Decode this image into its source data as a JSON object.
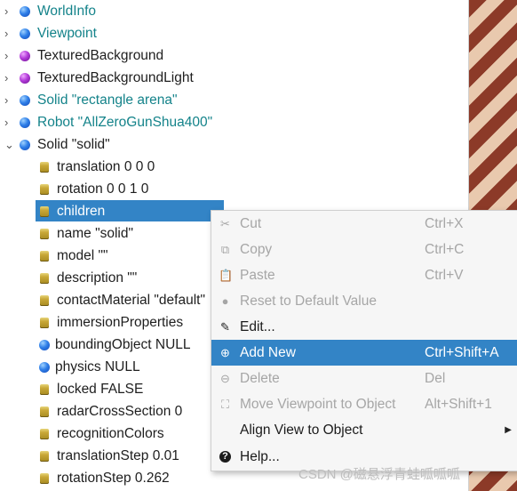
{
  "scene_tree": {
    "nodes": [
      {
        "label": "WorldInfo",
        "expander": "›",
        "icon": "blue-sphere-icon",
        "style": "teal"
      },
      {
        "label": "Viewpoint",
        "expander": "›",
        "icon": "blue-sphere-icon",
        "style": "teal"
      },
      {
        "label": "TexturedBackground",
        "expander": "›",
        "icon": "purple-sphere-icon",
        "style": "normal"
      },
      {
        "label": "TexturedBackgroundLight",
        "expander": "›",
        "icon": "purple-sphere-icon",
        "style": "normal"
      },
      {
        "label": "Solid \"rectangle arena\"",
        "expander": "›",
        "icon": "blue-sphere-icon",
        "style": "teal"
      },
      {
        "label": "Robot \"AllZeroGunShua400\"",
        "expander": "›",
        "icon": "blue-sphere-icon",
        "style": "teal"
      },
      {
        "label": "Solid \"solid\"",
        "expander": "⌄",
        "icon": "blue-sphere-icon",
        "style": "normal"
      }
    ],
    "fields": [
      {
        "label": "translation 0 0 0",
        "icon": "field-icon"
      },
      {
        "label": "rotation 0 0 1 0",
        "icon": "field-icon"
      },
      {
        "label": "children",
        "icon": "field-icon",
        "selected": true
      },
      {
        "label": "name \"solid\"",
        "icon": "field-icon"
      },
      {
        "label": "model \"\"",
        "icon": "field-icon"
      },
      {
        "label": "description \"\"",
        "icon": "field-icon"
      },
      {
        "label": "contactMaterial \"default\"",
        "icon": "field-icon"
      },
      {
        "label": "immersionProperties",
        "icon": "field-icon"
      },
      {
        "label": "boundingObject NULL",
        "icon": "blue-sphere-icon"
      },
      {
        "label": "physics NULL",
        "icon": "blue-sphere-icon"
      },
      {
        "label": "locked FALSE",
        "icon": "field-icon"
      },
      {
        "label": "radarCrossSection 0",
        "icon": "field-icon"
      },
      {
        "label": "recognitionColors",
        "icon": "field-icon"
      },
      {
        "label": "translationStep 0.01",
        "icon": "field-icon"
      },
      {
        "label": "rotationStep 0.262",
        "icon": "field-icon"
      }
    ]
  },
  "context_menu": {
    "items": [
      {
        "label": "Cut",
        "shortcut": "Ctrl+X",
        "icon": "scissors-icon",
        "glyph": "✂",
        "enabled": false
      },
      {
        "label": "Copy",
        "shortcut": "Ctrl+C",
        "icon": "copy-icon",
        "glyph": "⧉",
        "enabled": false
      },
      {
        "label": "Paste",
        "shortcut": "Ctrl+V",
        "icon": "paste-icon",
        "glyph": "📋",
        "enabled": false
      },
      {
        "label": "Reset to Default Value",
        "shortcut": "",
        "icon": "reset-icon",
        "glyph": "●",
        "enabled": false
      },
      {
        "label": "Edit...",
        "shortcut": "",
        "icon": "edit-icon",
        "glyph": "✎",
        "enabled": true
      },
      {
        "label": "Add New",
        "shortcut": "Ctrl+Shift+A",
        "icon": "add-icon",
        "glyph": "⊕",
        "enabled": true,
        "highlighted": true
      },
      {
        "label": "Delete",
        "shortcut": "Del",
        "icon": "delete-icon",
        "glyph": "⊖",
        "enabled": false
      },
      {
        "label": "Move Viewpoint to Object",
        "shortcut": "Alt+Shift+1",
        "icon": "move-viewpoint-icon",
        "glyph": "⛶",
        "enabled": false
      },
      {
        "label": "Align View to Object",
        "shortcut": "",
        "icon": "",
        "glyph": "",
        "enabled": true,
        "submenu": "▶"
      },
      {
        "label": "Help...",
        "shortcut": "",
        "icon": "help-icon",
        "glyph": "?",
        "enabled": true
      }
    ]
  },
  "watermark": "CSDN @磁悬浮青蛙呱呱呱",
  "colors": {
    "selection": "#3384c6",
    "teal_text": "#14838a",
    "disabled": "#a6a6a6"
  }
}
